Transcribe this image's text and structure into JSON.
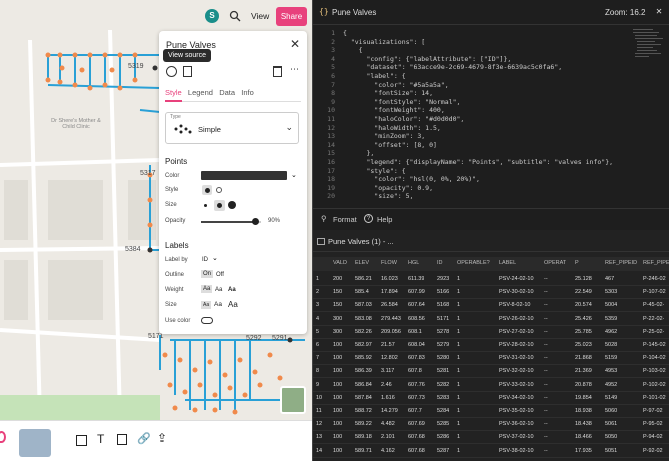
{
  "top": {
    "avatar_letter": "S",
    "view_label": "View",
    "share_label": "Share"
  },
  "map": {
    "labels": [
      "5319",
      "5317",
      "5384",
      "5171",
      "5292",
      "5291"
    ],
    "place": "Dr Shere's Mother & Child Clinic"
  },
  "panel": {
    "title": "Pune Valves",
    "tooltip": "View source",
    "tabs": [
      "Style",
      "Legend",
      "Data",
      "Info"
    ],
    "type_label": "Type",
    "type_value": "Simple",
    "points_heading": "Points",
    "color_label": "Color",
    "style_label": "Style",
    "size_label": "Size",
    "opacity_label": "Opacity",
    "opacity_value": "90%",
    "opacity": 0.9,
    "labels_heading": "Labels",
    "label_by_label": "Label by",
    "label_by_value": "ID",
    "outline_label": "Outline",
    "outline_on": "On",
    "outline_off": "Off",
    "weight_label": "Weight",
    "size2_label": "Size",
    "aa": "Aa",
    "use_color_label": "Use color"
  },
  "editor": {
    "file_name": "Pune Valves",
    "zoom_label": "Zoom: 16.2",
    "format_label": "Format",
    "help_label": "Help",
    "lines": [
      "{",
      "  \"visualizations\": [",
      "    {",
      "      \"config\": {\"labelAttribute\": [\"ID\"]},",
      "      \"dataset\": \"63acce9e-2c69-4679-8f3e-6639ac5c0fa6\",",
      "      \"label\": {",
      "        \"color\": \"#5a5a5a\",",
      "        \"fontSize\": 14,",
      "        \"fontStyle\": \"Normal\",",
      "        \"fontWeight\": 400,",
      "        \"haloColor\": \"#d0d0d0\",",
      "        \"haloWidth\": 1.5,",
      "        \"minZoom\": 3,",
      "        \"offset\": [8, 0]",
      "      },",
      "      \"legend\": {\"displayName\": \"Points\", \"subtitle\": \"valves info\"},",
      "      \"style\": {",
      "        \"color\": \"hsl(0, 0%, 20%)\",",
      "        \"opacity\": 0.9,",
      "        \"size\": 5,"
    ]
  },
  "table": {
    "name": "Pune Valves (1) - ...",
    "columns": [
      "",
      "VALD",
      "ELEV",
      "FLOW",
      "HGL",
      "ID",
      "OPERABLE?",
      "LABEL",
      "OPERAT",
      "P",
      "REF_PIPEID",
      "REF_PIPE"
    ],
    "rows": [
      [
        "1",
        "200",
        "586.21",
        "16.023",
        "611.39",
        "2923",
        "1",
        "PSV-24-02-10",
        "--",
        "25.128",
        "467",
        "P-246-02"
      ],
      [
        "2",
        "150",
        "585.4",
        "17.894",
        "607.99",
        "5166",
        "1",
        "PSV-30-02-10",
        "--",
        "22.549",
        "5303",
        "P-107-02"
      ],
      [
        "3",
        "150",
        "587.03",
        "26.584",
        "607.64",
        "5168",
        "1",
        "PSV-8-02-10",
        "--",
        "20.574",
        "5004",
        "P-45-02-"
      ],
      [
        "4",
        "300",
        "583.08",
        "279.443",
        "608.56",
        "5171",
        "1",
        "PSV-26-02-10",
        "--",
        "25.426",
        "5359",
        "P-22-02-"
      ],
      [
        "5",
        "300",
        "582.26",
        "209.056",
        "608.1",
        "5278",
        "1",
        "PSV-27-02-10",
        "--",
        "25.785",
        "4962",
        "P-25-02-"
      ],
      [
        "6",
        "100",
        "582.97",
        "21.57",
        "608.04",
        "5279",
        "1",
        "PSV-28-02-10",
        "--",
        "25.023",
        "5028",
        "P-145-02"
      ],
      [
        "7",
        "100",
        "585.92",
        "12.802",
        "607.83",
        "5280",
        "1",
        "PSV-31-02-10",
        "--",
        "21.868",
        "5159",
        "P-104-02"
      ],
      [
        "8",
        "100",
        "586.39",
        "3.117",
        "607.8",
        "5281",
        "1",
        "PSV-32-02-10",
        "--",
        "21.369",
        "4953",
        "P-103-02"
      ],
      [
        "9",
        "100",
        "586.84",
        "2.46",
        "607.76",
        "5282",
        "1",
        "PSV-33-02-10",
        "--",
        "20.878",
        "4952",
        "P-102-02"
      ],
      [
        "10",
        "100",
        "587.84",
        "1.616",
        "607.73",
        "5283",
        "1",
        "PSV-34-02-10",
        "--",
        "19.854",
        "5149",
        "P-101-02"
      ],
      [
        "11",
        "100",
        "588.72",
        "14.279",
        "607.7",
        "5284",
        "1",
        "PSV-35-02-10",
        "--",
        "18.938",
        "5060",
        "P-97-02"
      ],
      [
        "12",
        "100",
        "589.22",
        "4.482",
        "607.69",
        "5285",
        "1",
        "PSV-36-02-10",
        "--",
        "18.438",
        "5061",
        "P-95-02"
      ],
      [
        "13",
        "100",
        "589.18",
        "2.101",
        "607.68",
        "5286",
        "1",
        "PSV-37-02-10",
        "--",
        "18.466",
        "5050",
        "P-94-02"
      ],
      [
        "14",
        "100",
        "589.71",
        "4.162",
        "607.68",
        "5287",
        "1",
        "PSV-38-02-10",
        "--",
        "17.935",
        "5051",
        "P-92-02"
      ]
    ]
  },
  "colors": {
    "accent": "#e8417c",
    "pipe": "#29a0d6",
    "valve": "#f08a4b",
    "editor_bg": "#1e1e1e"
  }
}
